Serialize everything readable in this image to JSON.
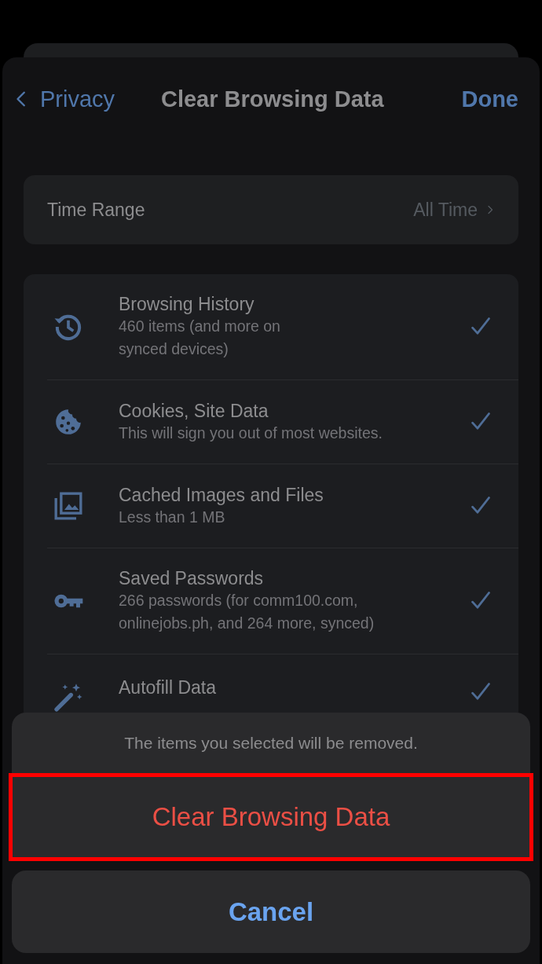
{
  "nav": {
    "back": "Privacy",
    "title": "Clear Browsing Data",
    "done": "Done"
  },
  "time_range": {
    "label": "Time Range",
    "value": "All Time"
  },
  "items": [
    {
      "kind": "history",
      "title": "Browsing History",
      "subtitle": "460 items (and more on\nsynced devices)",
      "checked": true
    },
    {
      "kind": "cookie",
      "title": "Cookies, Site Data",
      "subtitle": "This will sign you out of most websites.",
      "checked": true
    },
    {
      "kind": "images",
      "title": "Cached Images and Files",
      "subtitle": "Less than 1 MB",
      "checked": true
    },
    {
      "kind": "key",
      "title": "Saved Passwords",
      "subtitle": "266 passwords (for comm100.com,\nonlinejobs.ph, and 264 more, synced)",
      "checked": true
    },
    {
      "kind": "wand",
      "title": "Autofill Data",
      "checked": true
    }
  ],
  "action_sheet": {
    "message": "The items you selected will be removed.",
    "action": {
      "label": "Clear Browsing Data",
      "highlighted": true
    },
    "cancel": "Cancel"
  }
}
